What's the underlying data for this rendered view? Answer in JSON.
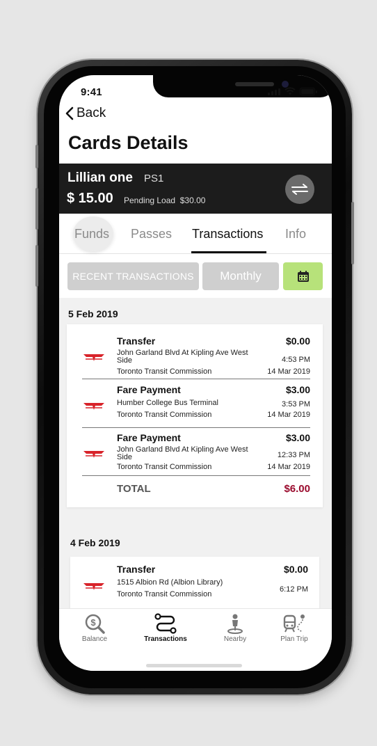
{
  "status": {
    "time": "9:41"
  },
  "nav": {
    "back_label": "Back",
    "title": "Cards Details"
  },
  "card": {
    "name": "Lillian one",
    "type": "PS1",
    "balance": "$ 15.00",
    "pending_label": "Pending Load",
    "pending_amount": "$30.00"
  },
  "tabs": [
    {
      "label": "Funds",
      "active": false
    },
    {
      "label": "Passes",
      "active": false
    },
    {
      "label": "Transactions",
      "active": true
    },
    {
      "label": "Info",
      "active": false
    }
  ],
  "filters": {
    "recent": "RECENT TRANSACTIONS",
    "monthly": "Monthly",
    "calendar_icon": "calendar-icon"
  },
  "colors": {
    "accent_green": "#b7e27a",
    "total_red": "#9b0c2e",
    "ttc_red": "#d8232a",
    "card_bar": "#1c1c1c"
  },
  "groups": [
    {
      "date": "5 Feb 2019",
      "transactions": [
        {
          "type": "Transfer",
          "location": "John Garland Blvd At Kipling Ave West Side",
          "agency": "Toronto Transit Commission",
          "amount": "$0.00",
          "time": "4:53 PM",
          "date": "14 Mar 2019"
        },
        {
          "type": "Fare Payment",
          "location": "Humber College Bus Terminal",
          "agency": "Toronto Transit Commission",
          "amount": "$3.00",
          "time": "3:53 PM",
          "date": "14 Mar 2019"
        },
        {
          "type": "Fare Payment",
          "location": "John Garland Blvd At Kipling Ave West Side",
          "agency": "Toronto Transit Commission",
          "amount": "$3.00",
          "time": "12:33 PM",
          "date": "14 Mar 2019"
        }
      ],
      "total_label": "TOTAL",
      "total_amount": "$6.00"
    },
    {
      "date": "4 Feb 2019",
      "transactions": [
        {
          "type": "Transfer",
          "location": "1515 Albion Rd (Albion Library)",
          "agency": "Toronto Transit Commission",
          "amount": "$0.00",
          "time": "6:12 PM"
        }
      ]
    }
  ],
  "bottom_nav": [
    {
      "label": "Balance",
      "icon": "balance-icon",
      "active": false
    },
    {
      "label": "Transactions",
      "icon": "transactions-icon",
      "active": true
    },
    {
      "label": "Nearby",
      "icon": "nearby-icon",
      "active": false
    },
    {
      "label": "Plan Trip",
      "icon": "plan-trip-icon",
      "active": false
    }
  ]
}
